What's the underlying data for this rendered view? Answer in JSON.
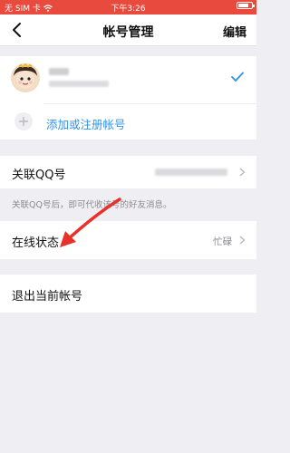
{
  "status_bar": {
    "carrier": "无 SIM 卡",
    "time": "下午3:26"
  },
  "nav": {
    "title": "帐号管理",
    "edit_label": "编辑"
  },
  "accounts": {
    "add_label": "添加或注册帐号"
  },
  "linked_qq": {
    "label": "关联QQ号",
    "hint": "关联QQ号后，即可代收该号的好友消息。"
  },
  "online_status": {
    "label": "在线状态",
    "value": "忙碌"
  },
  "logout": {
    "label": "退出当前帐号"
  },
  "colors": {
    "status_bar": "#e84a3d",
    "accent": "#2f93ea",
    "annotation_arrow": "#e8312a"
  },
  "icons": [
    "back-icon",
    "wifi-icon",
    "battery-icon",
    "checkmark-icon",
    "plus-icon",
    "chevron-right-icon"
  ]
}
